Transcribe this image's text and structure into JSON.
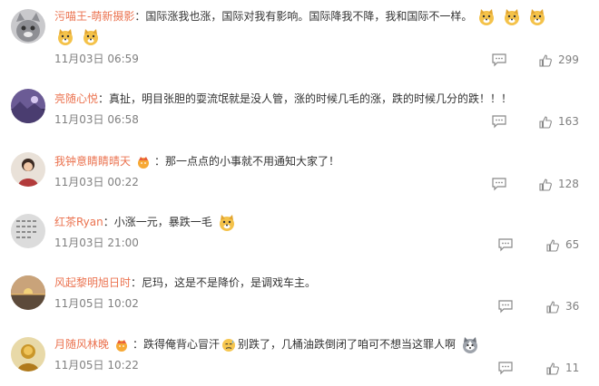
{
  "comments": [
    {
      "user": "污喵王-萌新摄影",
      "sep": "：",
      "text_parts": [
        "国际涨我也涨，国际对我有影响。国际降我不降，我和国际不一样。"
      ],
      "time": "11月03日 06:59",
      "likes": "299",
      "avatar": "cat-avatar",
      "emoji_icon": "laughing-doge-emoji"
    },
    {
      "user": "亮随心悦",
      "sep": "：",
      "text_parts": [
        "真扯，明目张胆的耍流氓就是没人管，涨的时候几毛的涨，跌的时候几分的跌！！！"
      ],
      "time": "11月03日 06:58",
      "likes": "163",
      "avatar": "purple-landscape-avatar"
    },
    {
      "user": "我钟意睛睛晴天",
      "sep": "：",
      "text_parts": [
        "那一点点的小事就不用通知大家了！"
      ],
      "time": "11月03日 00:22",
      "likes": "128",
      "avatar": "person-avatar",
      "badge_icon": "vip-badge-icon"
    },
    {
      "user": "红茶Ryan",
      "sep": "：",
      "text_parts": [
        "小涨一元，暴跌一毛"
      ],
      "time": "11月03日 21:00",
      "likes": "65",
      "avatar": "text-image-avatar",
      "emoji_icon": "laughing-doge-emoji"
    },
    {
      "user": "风起黎明旭日时",
      "sep": "：",
      "text_parts": [
        "尼玛，这是不是降价，是调戏车主。"
      ],
      "time": "11月05日 10:02",
      "likes": "36",
      "avatar": "sunset-avatar"
    },
    {
      "user": "月随风林晚",
      "sep": "：",
      "text_parts": [
        "跌得俺背心冒汗",
        "别跌了，几桶油跌倒闭了咱可不想当这罪人啊"
      ],
      "time": "11月05日 10:22",
      "likes": "11",
      "avatar": "golden-figure-avatar",
      "badge_icon": "vip-badge-icon",
      "emoji_icon": "sweat-face-emoji",
      "emoji_icon2": "husky-emoji"
    }
  ],
  "colors": {
    "username": "#eb7350",
    "text": "#333333",
    "meta": "#808080"
  }
}
